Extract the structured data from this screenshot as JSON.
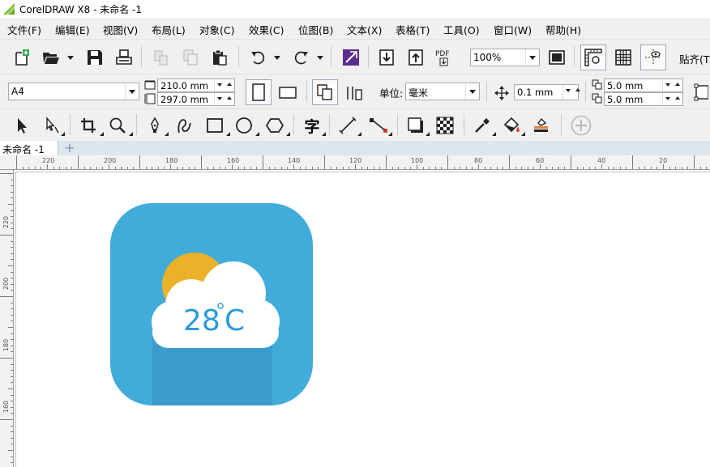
{
  "window": {
    "title": "CorelDRAW X8 - 未命名 -1"
  },
  "menu": {
    "file": "文件(F)",
    "edit": "编辑(E)",
    "view": "视图(V)",
    "layout": "布局(L)",
    "object": "对象(C)",
    "effects": "效果(C)",
    "bitmaps": "位图(B)",
    "text": "文本(X)",
    "table": "表格(T)",
    "tools": "工具(O)",
    "window": "窗口(W)",
    "help": "帮助(H)"
  },
  "standard_toolbar": {
    "pdf_label": "PDF",
    "zoom_level": "100%",
    "snap_label": "贴齐(T"
  },
  "property_bar": {
    "page_size": "A4",
    "page_width": "210.0 mm",
    "page_height": "297.0 mm",
    "units_label": "单位:",
    "units_value": "毫米",
    "nudge_distance": "0.1 mm",
    "duplicate_x": "5.0 mm",
    "duplicate_y": "5.0 mm"
  },
  "toolbox": {
    "text_tool_glyph": "字"
  },
  "document_tabs": {
    "active": "未命名 -1",
    "add": "+"
  },
  "rulers": {
    "horizontal_labels": [
      "220",
      "200",
      "180",
      "160",
      "140",
      "120",
      "100",
      "80",
      "60",
      "40",
      "20"
    ],
    "vertical_labels": [
      "220",
      "200",
      "180",
      "160"
    ]
  },
  "artwork": {
    "temperature_number": "28",
    "temperature_unit": "C",
    "colors": {
      "background": "#41acd9",
      "shadow": "#3a9bcc",
      "sun": "#ebb128",
      "cloud": "#ffffff",
      "text": "#2b9bdb"
    }
  }
}
